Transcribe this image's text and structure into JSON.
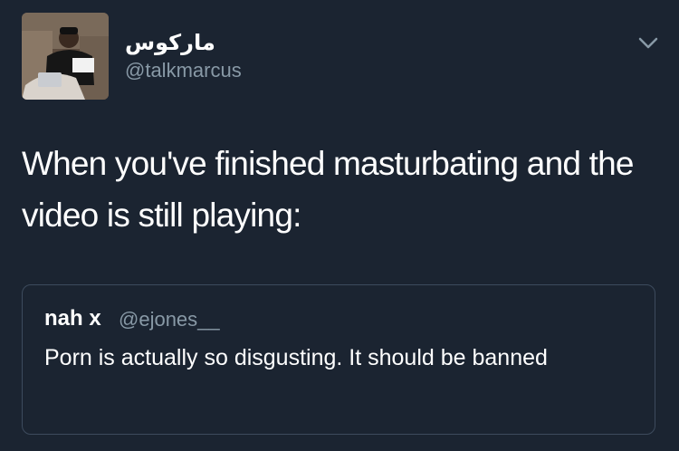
{
  "author": {
    "display_name": "ماركوس",
    "handle": "@talkmarcus",
    "avatar_icon": "profile-photo"
  },
  "menu": {
    "icon": "chevron-down-icon",
    "color": "#8899a6"
  },
  "tweet": {
    "text": "When you've finished masturbating and the video is still playing:"
  },
  "quoted_tweet": {
    "display_name": "nah x",
    "handle": "@ejones__",
    "text": "Porn is actually so disgusting. It should be banned"
  },
  "colors": {
    "background": "#1b2431",
    "text": "#ffffff",
    "secondary_text": "#8899a6",
    "quote_border": "#3d4b5d"
  }
}
